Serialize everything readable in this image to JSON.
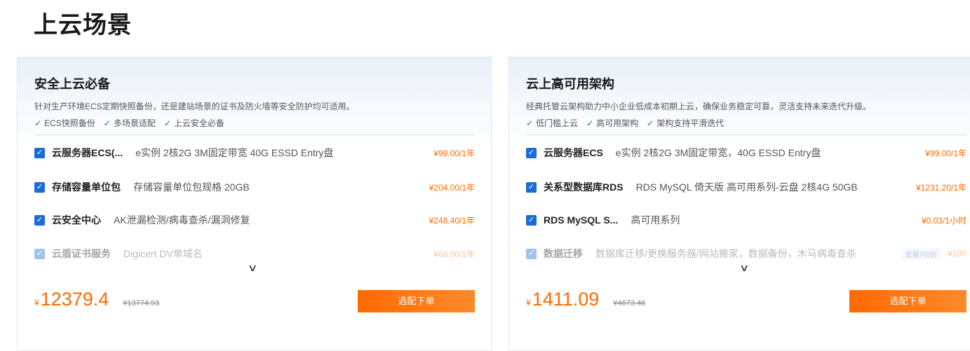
{
  "page_title": "上云场景",
  "cards": [
    {
      "title": "安全上云必备",
      "desc": "针对生产环境ECS定期快照备份，还是建站场景的证书及防火墙等安全防护均可适用。",
      "features": [
        "ECS快照备份",
        "多场景适配",
        "上云安全必备"
      ],
      "items": [
        {
          "name": "云服务器ECS(...",
          "spec": "e实例 2核2G 3M固定带宽 40G ESSD Entry盘",
          "price": "¥99.00/1年"
        },
        {
          "name": "存储容量单位包",
          "spec": "存储容量单位包规格 20GB",
          "price": "¥204.00/1年"
        },
        {
          "name": "云安全中心",
          "spec": "AK泄漏检测/病毒查杀/漏洞修复",
          "price": "¥248.40/1年"
        },
        {
          "name": "云盾证书服务",
          "spec": "Digicert DV单域名",
          "price": "¥68.00/1年"
        }
      ],
      "total_symbol": "¥",
      "total": "12379.4",
      "original": "¥13774.93",
      "button": "选配下单"
    },
    {
      "title": "云上高可用架构",
      "desc": "经典托管云架构助力中小企业低成本初期上云，确保业务稳定可靠，灵活支持未来迭代升级。",
      "features": [
        "低门槛上云",
        "高可用架构",
        "架构支持平滑迭代"
      ],
      "items": [
        {
          "name": "云服务器ECS",
          "spec": "e实例 2核2G 3M固定带宽，40G ESSD Entry盘",
          "price": "¥99.00/1年"
        },
        {
          "name": "关系型数据库RDS",
          "spec": "RDS MySQL 倚天版 高可用系列-云盘 2核4G 50GB",
          "price": "¥1231.20/1年"
        },
        {
          "name": "RDS MySQL S...",
          "spec": "高可用系列",
          "price": "¥0.03/1小时"
        },
        {
          "name": "数据迁移",
          "spec": "数据库迁移/更换服务器/网站搬家，数据备份，木马病毒查杀",
          "badge": "套餐内8折",
          "price": "¥100"
        }
      ],
      "total_symbol": "¥",
      "total": "1411.09",
      "original": "¥4673.46",
      "button": "选配下单"
    }
  ]
}
